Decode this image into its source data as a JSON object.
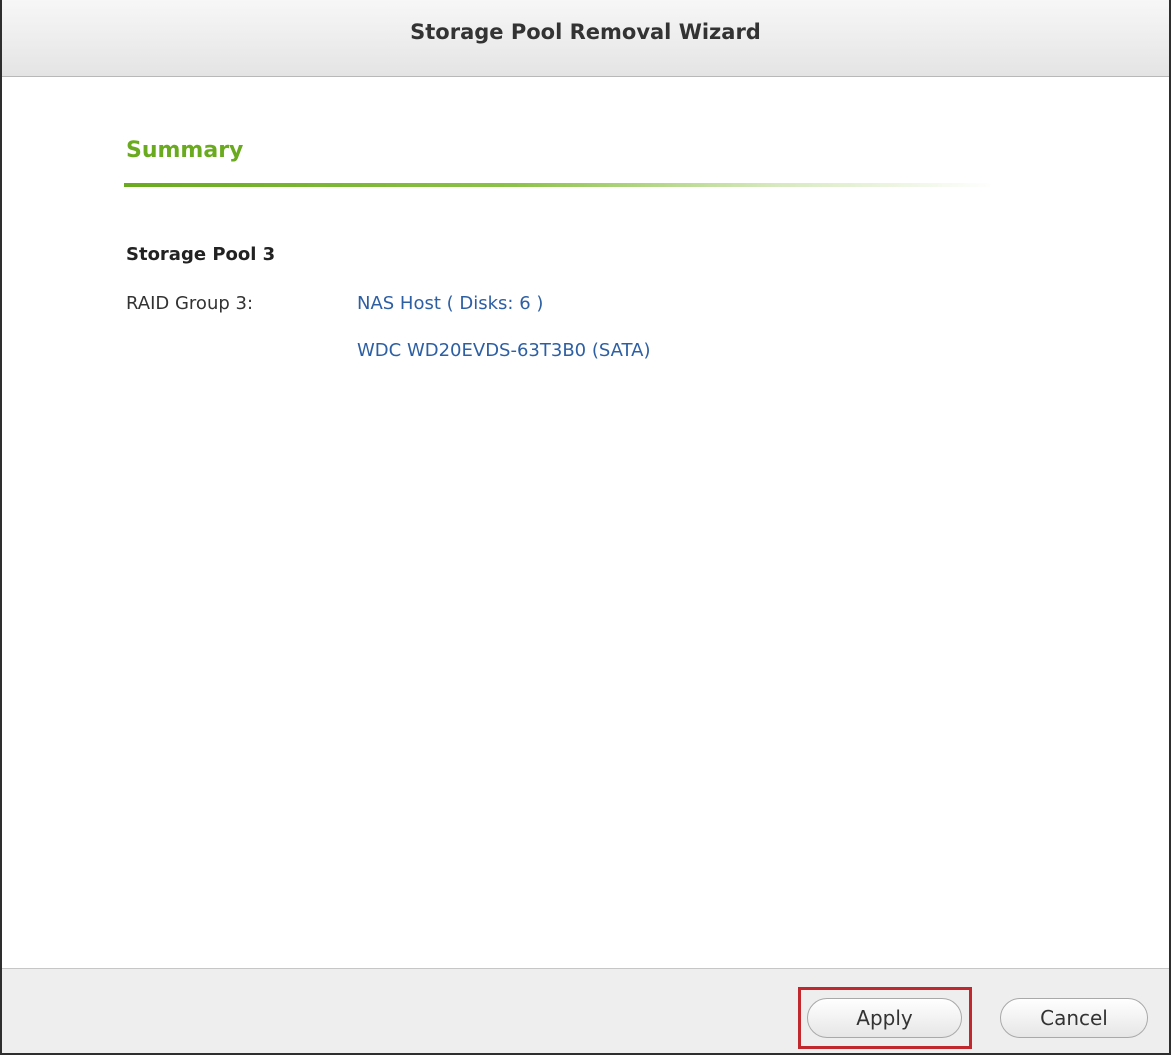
{
  "dialog": {
    "title": "Storage Pool Removal Wizard"
  },
  "summary": {
    "heading": "Summary",
    "pool_name": "Storage Pool 3",
    "raid_label": "RAID Group 3:",
    "raid_host": "NAS Host ( Disks: 6 )",
    "raid_disk": "WDC WD20EVDS-63T3B0 (SATA)"
  },
  "footer": {
    "apply_label": "Apply",
    "cancel_label": "Cancel"
  },
  "colors": {
    "accent_green": "#6aaa1e",
    "link_blue": "#2d5fa3",
    "highlight_red": "#c0282d"
  }
}
